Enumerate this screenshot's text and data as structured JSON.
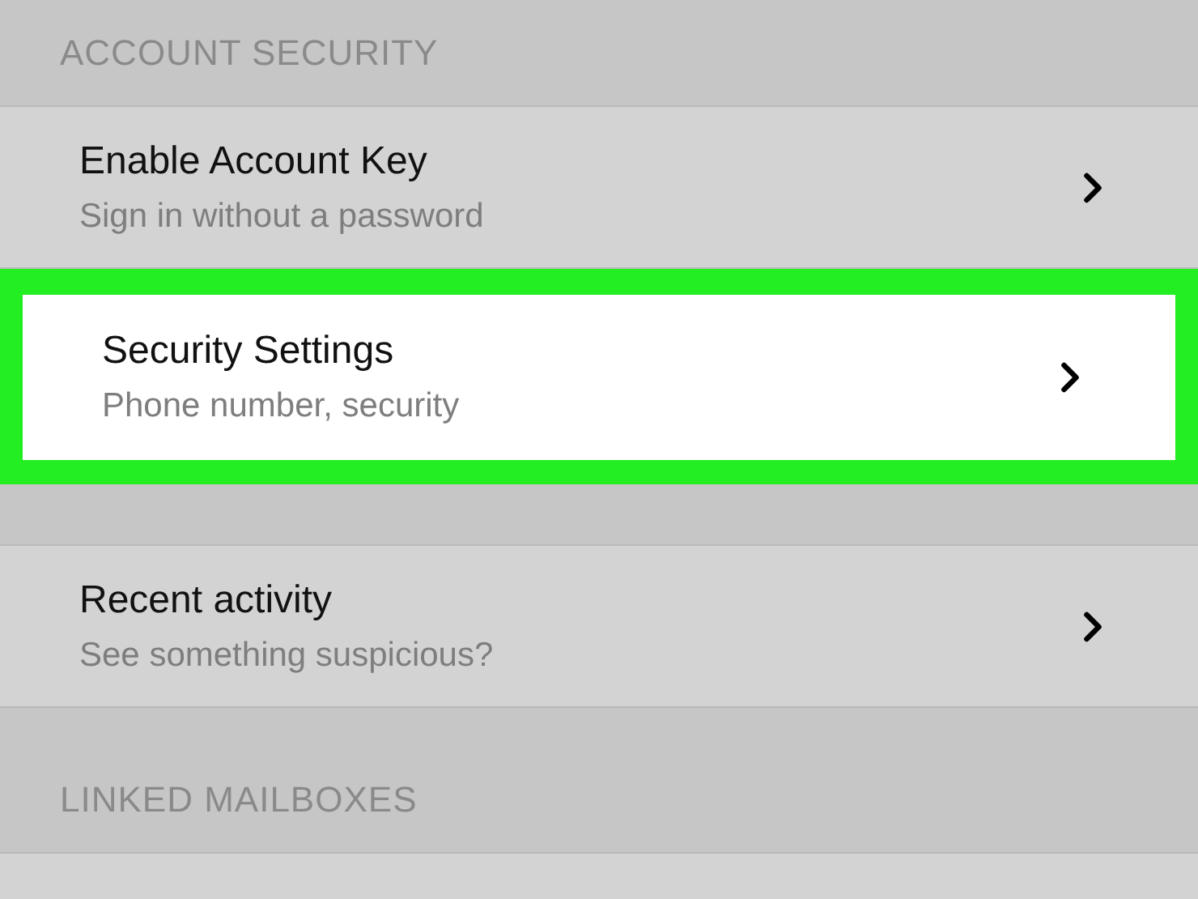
{
  "sections": [
    {
      "header": "ACCOUNT SECURITY",
      "rows": [
        {
          "title": "Enable Account Key",
          "subtitle": "Sign in without a password",
          "highlighted": false
        },
        {
          "title": "Security Settings",
          "subtitle": "Phone number, security",
          "highlighted": true
        }
      ]
    },
    {
      "rows": [
        {
          "title": "Recent activity",
          "subtitle": "See something suspicious?",
          "highlighted": false
        }
      ]
    },
    {
      "header": "LINKED MAILBOXES"
    }
  ]
}
